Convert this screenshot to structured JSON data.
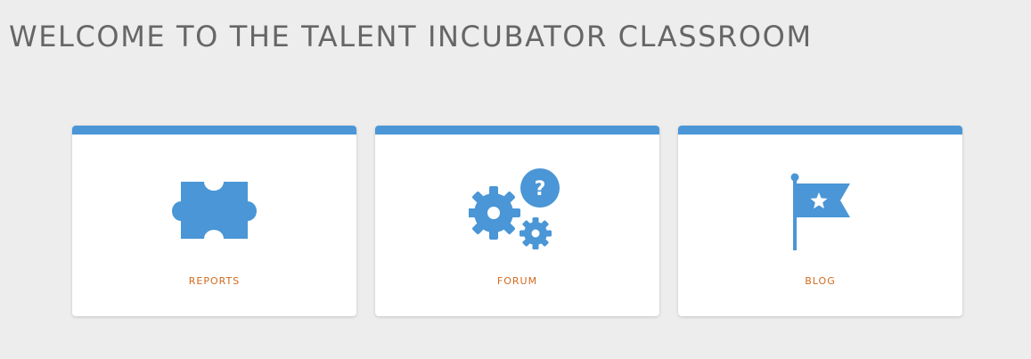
{
  "header": {
    "title": "WELCOME TO THE TALENT INCUBATOR CLASSROOM"
  },
  "cards": [
    {
      "label": "REPORTS",
      "icon": "puzzle-piece-icon"
    },
    {
      "label": "FORUM",
      "icon": "gears-question-icon"
    },
    {
      "label": "BLOG",
      "icon": "flag-star-icon"
    }
  ],
  "colors": {
    "background": "#ededed",
    "accent": "#4a96d6",
    "label": "#d2691e",
    "title": "#666666",
    "card": "#ffffff"
  }
}
